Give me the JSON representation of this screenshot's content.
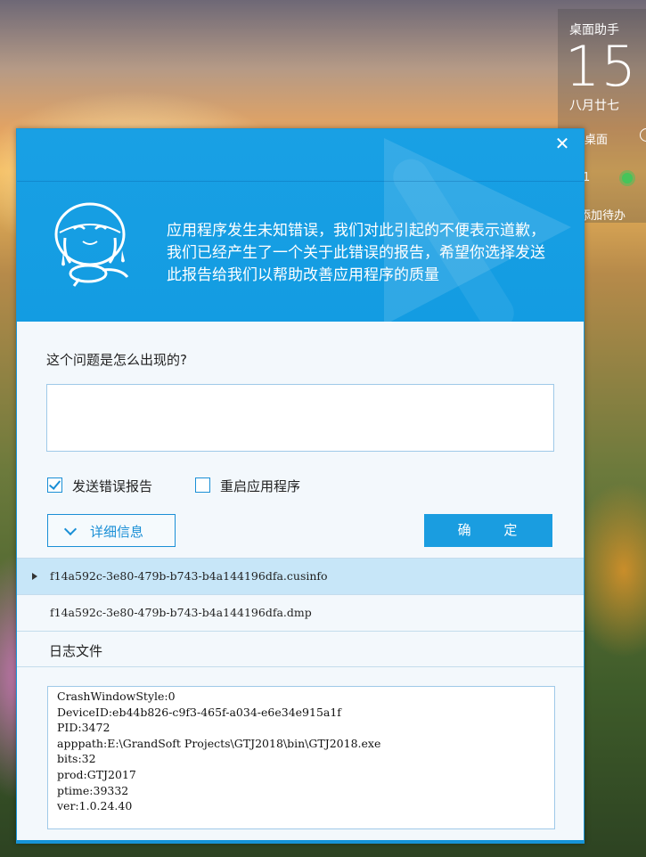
{
  "widget": {
    "title": "桌面助手",
    "time": "15",
    "date": "八月廿七",
    "desktop_label": "桌面",
    "count": "1",
    "todo_label": "添加待办"
  },
  "dialog": {
    "close_symbol": "✕",
    "message": "应用程序发生未知错误，我们对此引起的不便表示道歉，我们已经产生了一个关于此错误的报告，希望你选择发送此报告给我们以帮助改善应用程序的质量",
    "question": "这个问题是怎么出现的?",
    "description_value": "",
    "send_report": {
      "label": "发送错误报告",
      "checked": true
    },
    "restart_app": {
      "label": "重启应用程序",
      "checked": false
    },
    "details_button": "详细信息",
    "ok_button": "确 定",
    "files": [
      {
        "name": "f14a592c-3e80-479b-b743-b4a144196dfa.cusinfo",
        "selected": true
      },
      {
        "name": "f14a592c-3e80-479b-b743-b4a144196dfa.dmp",
        "selected": false
      }
    ],
    "log_heading": "日志文件",
    "log_lines": [
      "CrashWindowStyle:0",
      "DeviceID:eb44b826-c9f3-465f-a034-e6e34e915a1f",
      "PID:3472",
      "apppath:E:\\GrandSoft Projects\\GTJ2018\\bin\\GTJ2018.exe",
      "bits:32",
      "prod:GTJ2017",
      "ptime:39332",
      "ver:1.0.24.40"
    ]
  },
  "colors": {
    "accent": "#1a9de0",
    "header": "#19a0e4",
    "selected_row": "#c7e6f8"
  }
}
